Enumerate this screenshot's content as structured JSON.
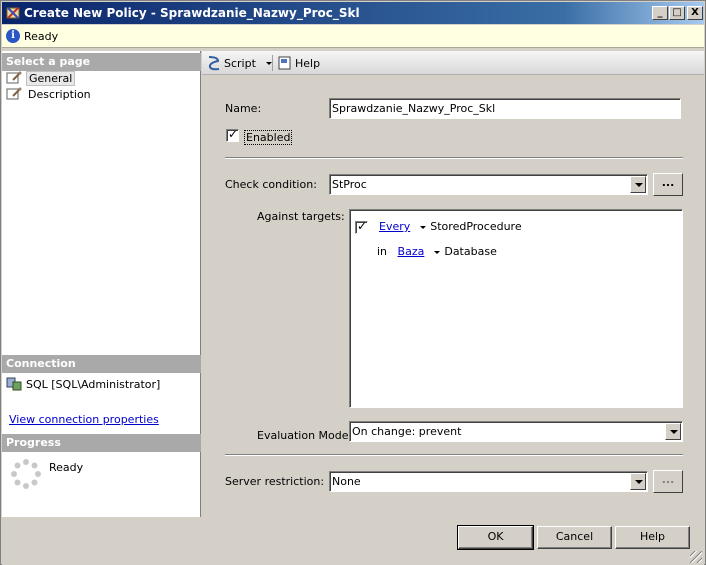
{
  "window": {
    "title": "Create New Policy - Sprawdzanie_Nazwy_Proc_Skl",
    "minimize": "_",
    "maximize": "□",
    "close": "X"
  },
  "status": {
    "text": "Ready",
    "icon": "info-icon"
  },
  "left_pane": {
    "select_page_header": "Select a page",
    "pages": [
      {
        "label": "General",
        "selected": true
      },
      {
        "label": "Description",
        "selected": false
      }
    ],
    "connection_header": "Connection",
    "connection_text": "SQL [SQL\\Administrator]",
    "view_connection_link": "View connection properties",
    "progress_header": "Progress",
    "progress_status": "Ready"
  },
  "toolbar": {
    "script_label": "Script",
    "help_label": "Help"
  },
  "form": {
    "name_label": "Name:",
    "name_value": "Sprawdzanie_Nazwy_Proc_Skl",
    "enabled_label": "Enabled",
    "enabled_checked": true,
    "check_condition_label": "Check condition:",
    "check_condition_value": "StProc",
    "against_targets_label": "Against targets:",
    "targets": {
      "row1_checked": true,
      "row1_link": "Every",
      "row1_text": "StoredProcedure",
      "row2_prefix": "in",
      "row2_link": "Baza",
      "row2_text": "Database"
    },
    "evaluation_mode_label": "Evaluation Mode:",
    "evaluation_mode_value": "On change: prevent",
    "server_restriction_label": "Server restriction:",
    "server_restriction_value": "None",
    "ellipsis": "..."
  },
  "buttons": {
    "ok": "OK",
    "cancel": "Cancel",
    "help": "Help"
  }
}
